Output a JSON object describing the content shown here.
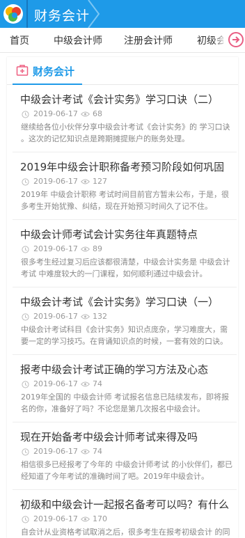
{
  "header": {
    "title": "财务会计"
  },
  "nav": {
    "items": [
      "首页",
      "中级会计师",
      "注册会计师",
      "初级会计"
    ]
  },
  "section": {
    "title": "财务会计"
  },
  "colors": {
    "brand_blue": "#1e9ae8",
    "nav_more_pink": "#e95d83",
    "section_icon_pink": "#ee5f80"
  },
  "articles": [
    {
      "title": "中级会计考试《会计实务》学习口诀（二）",
      "date": "2019-06-17",
      "views": "68",
      "summary": "继续给各位小伙伴分享中级会计考试《会计实务》的 学习口诀 。这次的记忆知识点是跨期摊提账户的账务处理。"
    },
    {
      "title": "2019年中级会计职称备考预习阶段如何巩固",
      "date": "2019-06-17",
      "views": "127",
      "summary": "2019年 中级会计职称 考试时间目前官方暂未公布，于是，很多考生开始犹豫、纠结，现在开始预习时间久了记不住。"
    },
    {
      "title": "中级会计师考试会计实务往年真题特点",
      "date": "2019-06-17",
      "views": "89",
      "summary": "很多考生经过复习后应该都很清楚，中级会计实务是 中级会计考试 中难度较大的一门课程，如何顺利通过中级会计。"
    },
    {
      "title": "中级会计考试《会计实务》学习口诀（一）",
      "date": "2019-06-17",
      "views": "132",
      "summary": "中级会计考试科目《会计实务》知识点庞杂，学习难度大，需要一定的学习技巧。在背诵知识点的时候，一套有效的口诀。"
    },
    {
      "title": "报考中级会计考试正确的学习方法及心态",
      "date": "2019-06-17",
      "views": "74",
      "summary": "2019年全国的 中级会计师 考试报名信息已陆续发布，即将报名的你，准备好了吗？不论您是第几次报名中级会计。"
    },
    {
      "title": "现在开始备考中级会计师考试来得及吗",
      "date": "2019-06-17",
      "views": "74",
      "summary": "相信很多已经报考了今年的 中级会计师考试 的小伙伴们，都已经知道了今年考试的准确时间了吧。2019年中级会计。"
    },
    {
      "title": "初级和中级会计一起报名备考可以吗？有什么",
      "date": "2019-06-17",
      "views": "170",
      "summary": "自会计从业资格考试取消之后，很多考生在报考初级会计 的同时也在考虑是否要同时报考中级会计考试。"
    }
  ]
}
